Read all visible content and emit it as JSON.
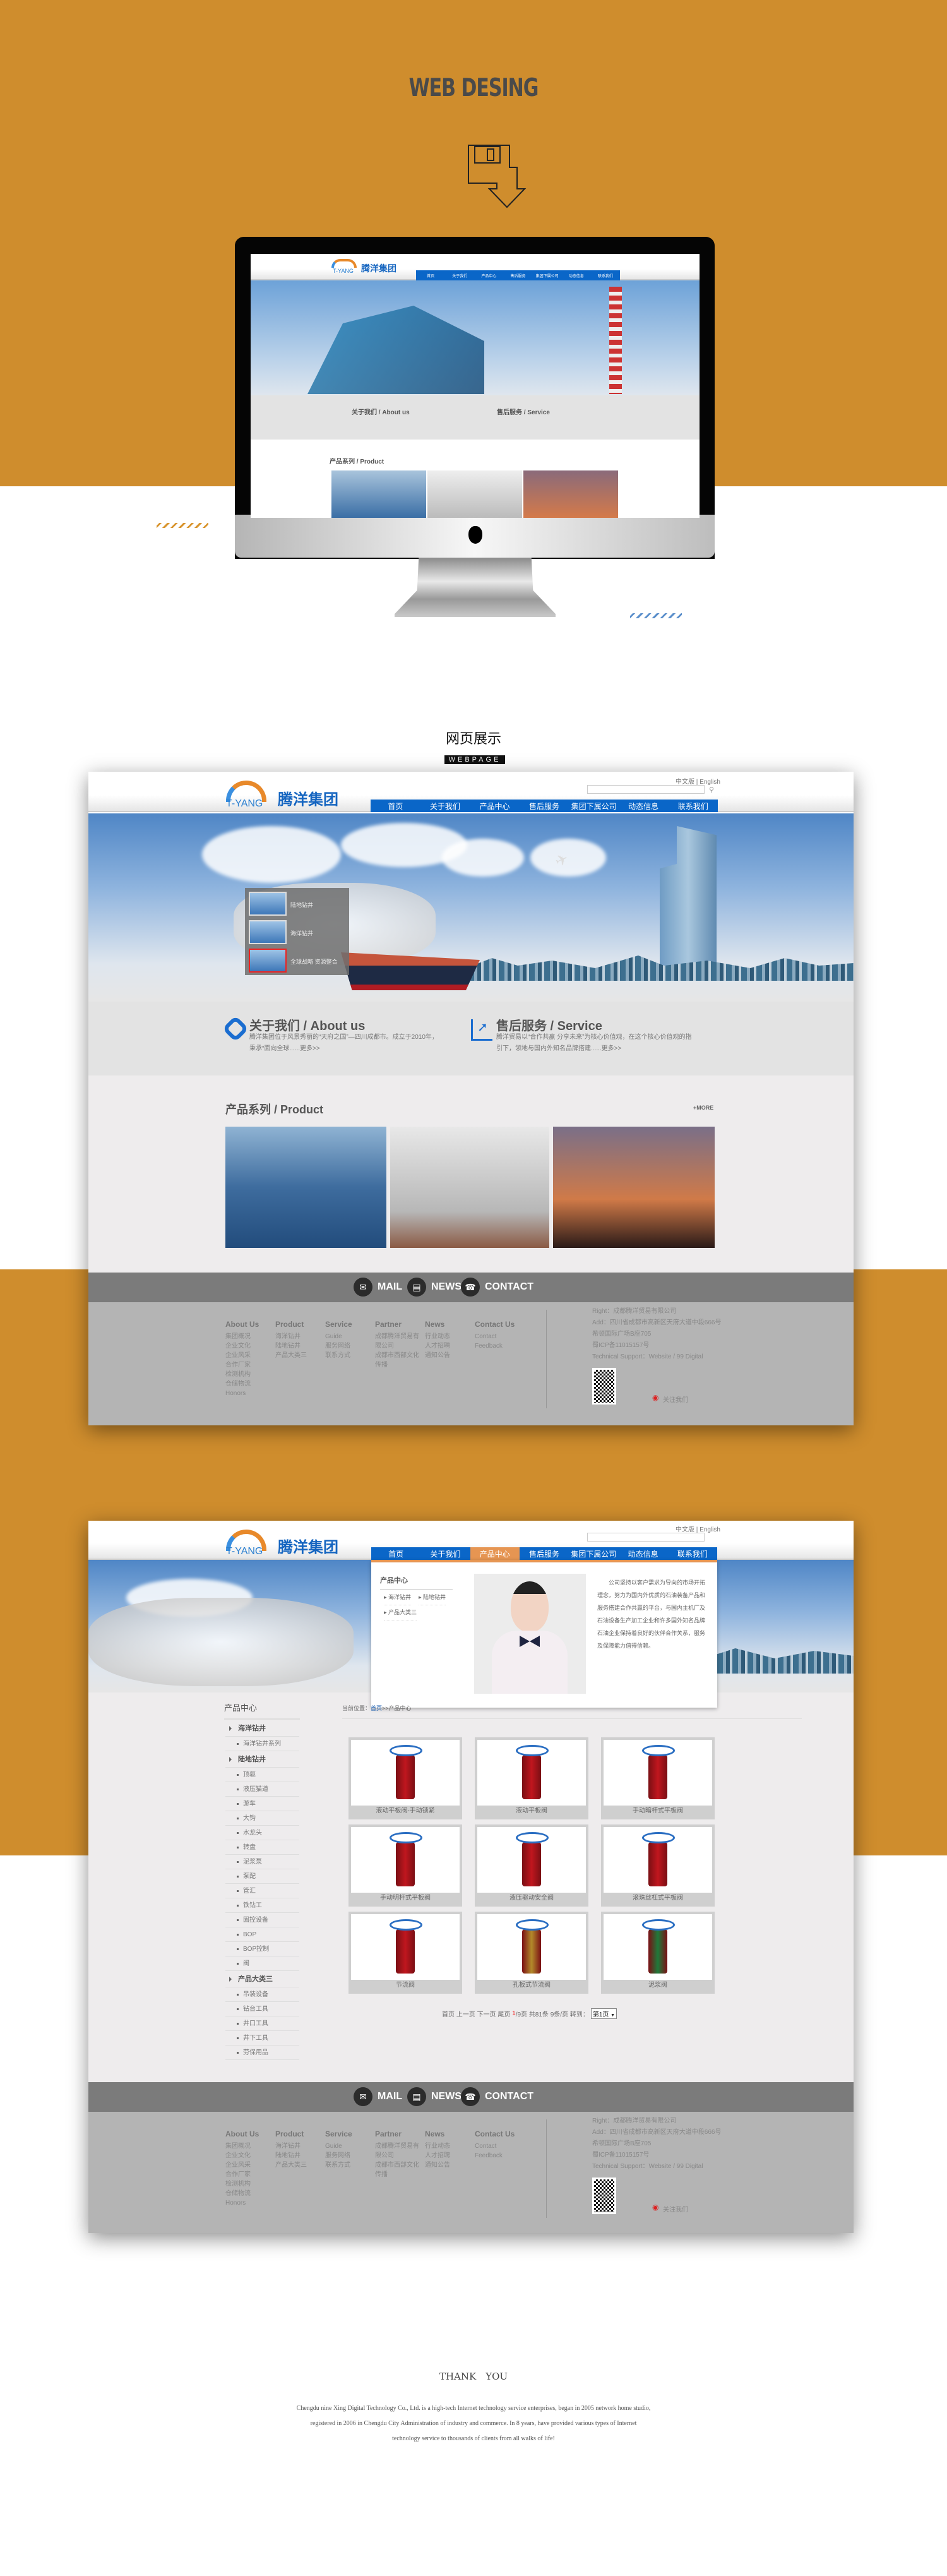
{
  "header": {
    "title": "WEB DESING",
    "icon": "save-download-icon"
  },
  "section": {
    "title": "网页展示",
    "subtitle": "WEBPAGE"
  },
  "colors": {
    "orange": "#cf8d2d",
    "nav_blue": "#0a66c8",
    "nav_active": "#e69552"
  },
  "site": {
    "logo_cn": "腾洋集团",
    "logo_en": "T-YANG",
    "lang": "中文版 | English",
    "nav": [
      "首页",
      "关于我们",
      "产品中心",
      "售后服务",
      "集团下属公司",
      "动态信息",
      "联系我们"
    ],
    "banner_thumbs": [
      "陆地钻井",
      "海洋钻井",
      "全球战略 资源整合"
    ],
    "about": {
      "title": "关于我们 / About us",
      "desc": "腾洋集团位于风景秀丽的“天府之国”—四川成都市。成立于2010年，秉承“面向全球......更多>>"
    },
    "service": {
      "title": "售后服务 / Service",
      "desc": "腾洋贸易以“合作共赢 分享未来”为核心价值观，在这个核心价值观的指引下，领地与国内外知名品牌搭建......更多>>"
    },
    "product_title": "产品系列 / Product",
    "more": "+MORE",
    "footer_buttons": [
      "MAIL",
      "NEWS",
      "CONTACT"
    ],
    "footer_cols": [
      {
        "title": "About Us",
        "items": [
          "集团概况",
          "企业文化",
          "企业风采",
          "合作厂家",
          "检测机构",
          "仓储物流",
          "Honors"
        ]
      },
      {
        "title": "Product",
        "items": [
          "海洋钻井",
          "陆地钻井",
          "产品大类三"
        ]
      },
      {
        "title": "Service",
        "items": [
          "Guide",
          "服务网络",
          "联系方式"
        ]
      },
      {
        "title": "Partner",
        "items": [
          "成都腾洋贸易有限公司",
          "成都市西部文化传播"
        ]
      },
      {
        "title": "News",
        "items": [
          "行业动态",
          "人才招聘",
          "通知公告"
        ]
      },
      {
        "title": "Contact Us",
        "items": [
          "Contact",
          "Feedback"
        ]
      }
    ],
    "info": [
      "Right：成都腾洋贸易有限公司",
      "Add：四川省成都市高新区天府大道中段666号",
      "希顿国际广场B座705",
      "蜀ICP备11015157号",
      "Technical Support：Website / 99 Digital"
    ],
    "follow": "关注我们"
  },
  "page2": {
    "dropdown": {
      "title": "产品中心",
      "items": [
        "海洋钻井",
        "陆地钻井",
        "产品大类三"
      ],
      "text": "公司坚持以客户需求为导向的市场开拓理念，努力为国内外优质的石油装备产品和服务搭建合作共赢的平台，与国内主机厂及石油设备生产加工企业和许多国外知名品牌石油企业保持着良好的伙伴合作关系，服务及保障能力值得信赖。"
    },
    "sidebar_title": "产品中心",
    "sidebar": [
      {
        "h": "海洋钻井"
      },
      {
        "s": "海洋钻井系列"
      },
      {
        "h": "陆地钻井"
      },
      {
        "s": "顶驱"
      },
      {
        "s": "液压猫道"
      },
      {
        "s": "游车"
      },
      {
        "s": "大钩"
      },
      {
        "s": "水龙头"
      },
      {
        "s": "转盘"
      },
      {
        "s": "泥浆泵"
      },
      {
        "s": "泵配"
      },
      {
        "s": "管汇"
      },
      {
        "s": "铁钻工"
      },
      {
        "s": "固控设备"
      },
      {
        "s": "BOP"
      },
      {
        "s": "BOP控制"
      },
      {
        "s": "阀"
      },
      {
        "h": "产品大类三"
      },
      {
        "s": "吊装设备"
      },
      {
        "s": "钻台工具"
      },
      {
        "s": "井口工具"
      },
      {
        "s": "井下工具"
      },
      {
        "s": "劳保用品"
      }
    ],
    "breadcrumb": {
      "label": "当前位置：",
      "home": "首页",
      "current": ">>产品中心"
    },
    "products": [
      "液动平板阀-手动锁紧",
      "液动平板阀",
      "手动暗杆式平板阀",
      "手动明杆式平板阀",
      "液压驱动安全阀",
      "滚珠丝杠式平板阀",
      "节流阀",
      "孔板式节流阀",
      "泥浆阀"
    ],
    "pager": {
      "links": "首页 上一页 下一页 尾页",
      "current": "1",
      "rest": "/9页 共81条 9条/页 转到：",
      "select": "第1页"
    }
  },
  "thanks": {
    "title": "THANK　YOU",
    "lines": [
      "Chengdu nine Xing Digital Technology Co., Ltd. is a high-tech Internet technology service enterprises, began in 2005 network home studio,",
      "registered in 2006 in Chengdu City Administration of industry and commerce. In 8 years, have provided various types of Internet",
      "technology service to thousands of clients from all walks of life!"
    ]
  }
}
